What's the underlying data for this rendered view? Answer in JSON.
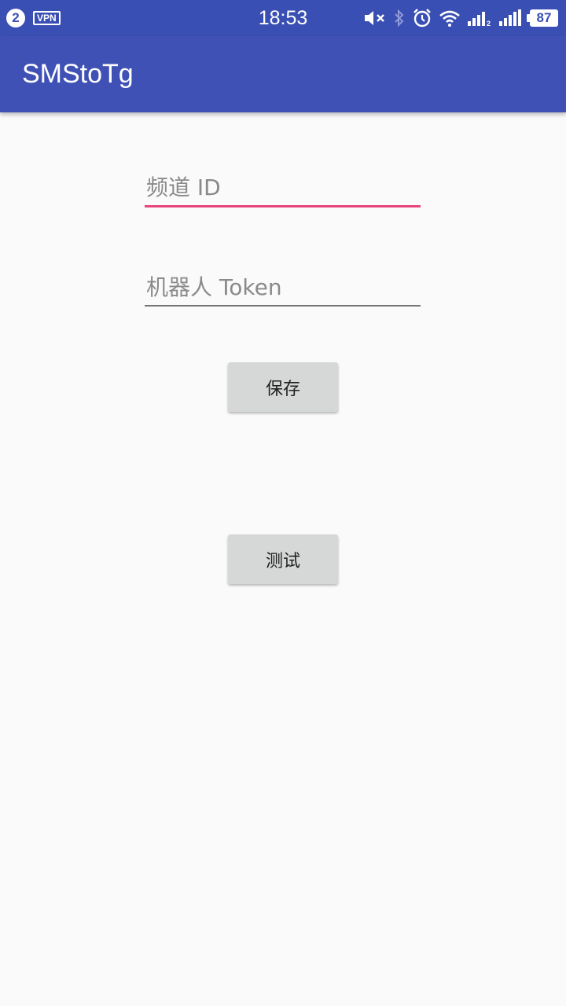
{
  "status_bar": {
    "notification_count": "2",
    "vpn_label": "VPN",
    "time": "18:53",
    "battery_level": "87",
    "icons": [
      "mute-icon",
      "bluetooth-icon",
      "alarm-icon",
      "wifi-icon",
      "signal-1-icon",
      "signal-2-icon"
    ]
  },
  "app_bar": {
    "title": "SMStoTg"
  },
  "form": {
    "channel_id": {
      "placeholder": "频道 ID",
      "value": "",
      "focused": true
    },
    "bot_token": {
      "placeholder": "机器人 Token",
      "value": "",
      "focused": false
    },
    "save_label": "保存",
    "test_label": "测试"
  },
  "colors": {
    "status_bar": "#3a4fb3",
    "app_bar": "#3f51b5",
    "accent": "#e8467c",
    "background": "#fafafa",
    "button": "#d6d7d7"
  }
}
